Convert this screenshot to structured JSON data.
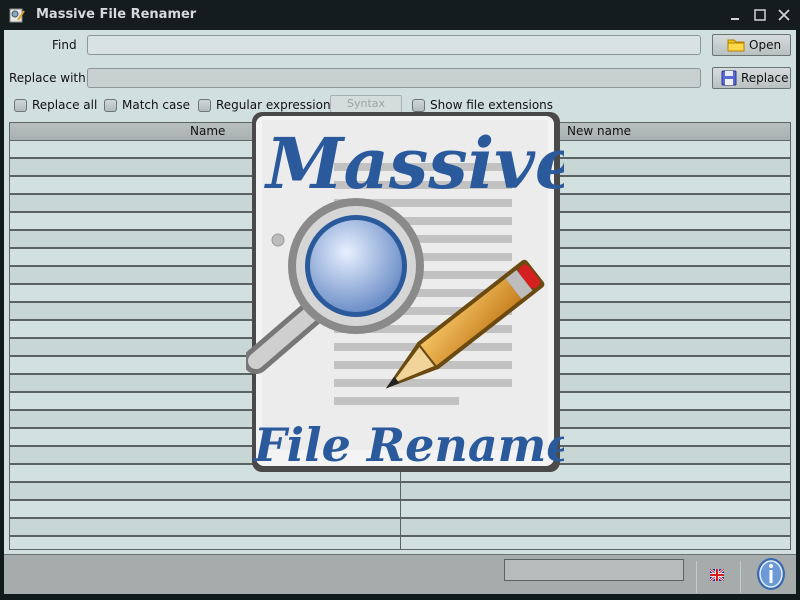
{
  "window": {
    "title": "Massive File Renamer",
    "controls": {
      "minimize": "minimize",
      "maximize": "maximize",
      "close": "close"
    }
  },
  "form": {
    "find_label": "Find",
    "find_value": "",
    "replace_label": "Replace with",
    "replace_value": "",
    "open_button": "Open",
    "replace_button": "Replace"
  },
  "options": {
    "replace_all": {
      "label": "Replace all",
      "checked": false
    },
    "match_case": {
      "label": "Match case",
      "checked": false
    },
    "regex": {
      "label": "Regular expressions",
      "checked": false
    },
    "syntax_button": "Syntax",
    "show_extensions": {
      "label": "Show file extensions",
      "checked": false
    }
  },
  "table": {
    "columns": [
      "Name",
      "New name"
    ],
    "rows": []
  },
  "splash": {
    "line1": "Massive",
    "line2": "File Renamer"
  },
  "status": {
    "progress": 0,
    "language": "English (UK)",
    "info_icon": "info-icon"
  },
  "colors": {
    "brand_blue": "#2a5a9c",
    "pencil_orange": "#e8a030",
    "eraser_red": "#d42020"
  }
}
